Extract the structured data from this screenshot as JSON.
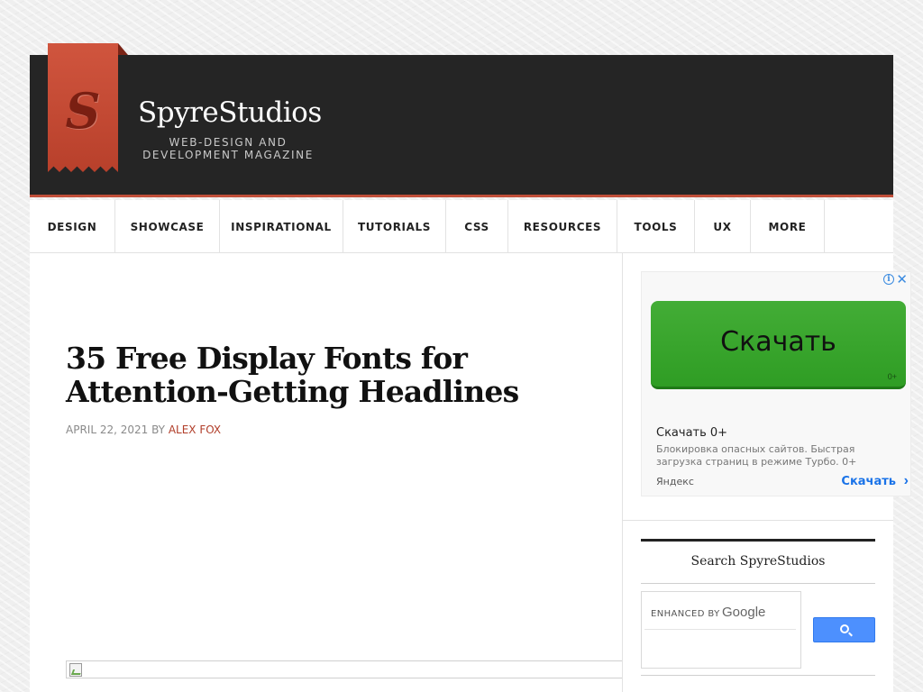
{
  "header": {
    "logo_letter": "S",
    "site_title": "SpyreStudios",
    "tagline_line1": "WEB-DESIGN AND",
    "tagline_line2": "DEVELOPMENT MAGAZINE"
  },
  "nav": {
    "items": [
      {
        "label": "DESIGN"
      },
      {
        "label": "SHOWCASE"
      },
      {
        "label": "INSPIRATIONAL"
      },
      {
        "label": "TUTORIALS"
      },
      {
        "label": "CSS"
      },
      {
        "label": "RESOURCES"
      },
      {
        "label": "TOOLS"
      },
      {
        "label": "UX"
      },
      {
        "label": "MORE"
      }
    ]
  },
  "post": {
    "title_line1": "35 Free Display Fonts for",
    "title_line2": "Attention-Getting Headlines",
    "date": "APRIL 22, 2021",
    "by": "BY",
    "author": "ALEX FOX"
  },
  "ad": {
    "info_glyph": "i",
    "close_glyph": "✕",
    "button_label": "Скачать",
    "button_small": "0+",
    "headline": "Скачать 0+",
    "description": "Блокировка опасных сайтов. Быстрая загрузка страниц в режиме Турбо. 0+",
    "source": "Яндекс",
    "cta": "Скачать",
    "cta_arrow": "›"
  },
  "search_widget": {
    "title": "Search SpyreStudios",
    "enhanced_by": "ENHANCED BY",
    "google": "Google"
  },
  "colors": {
    "header_bg": "#252525",
    "accent": "#c14f3a",
    "ad_button": "#3aa52e",
    "search_button": "#4d90fe"
  }
}
